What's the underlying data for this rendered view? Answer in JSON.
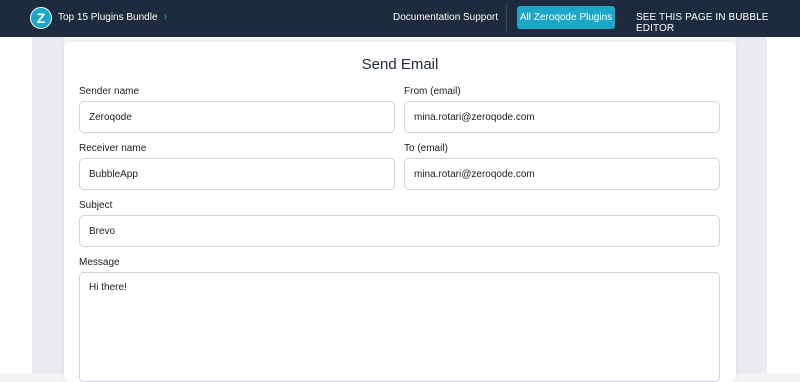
{
  "header": {
    "logo_letter": "Z",
    "bundle_title": "Top 15 Plugins Bundle",
    "chevron": "›",
    "nav": {
      "documentation": "Documentation",
      "support": "Support"
    },
    "plugins_button": "All Zeroqode Plugins",
    "editor_link": "SEE THIS PAGE IN BUBBLE EDITOR",
    "colors": {
      "background": "#1e2a3d",
      "accent": "#1aa7c8"
    }
  },
  "form": {
    "title": "Send Email",
    "sender_name": {
      "label": "Sender name",
      "value": "Zeroqode"
    },
    "from_email": {
      "label": "From (email)",
      "value": "mina.rotari@zeroqode.com"
    },
    "receiver_name": {
      "label": "Receiver name",
      "value": "BubbleApp"
    },
    "to_email": {
      "label": "To (email)",
      "value": "mina.rotari@zeroqode.com"
    },
    "subject": {
      "label": "Subject",
      "value": "Brevo"
    },
    "message": {
      "label": "Message",
      "value": "Hi there!"
    }
  }
}
